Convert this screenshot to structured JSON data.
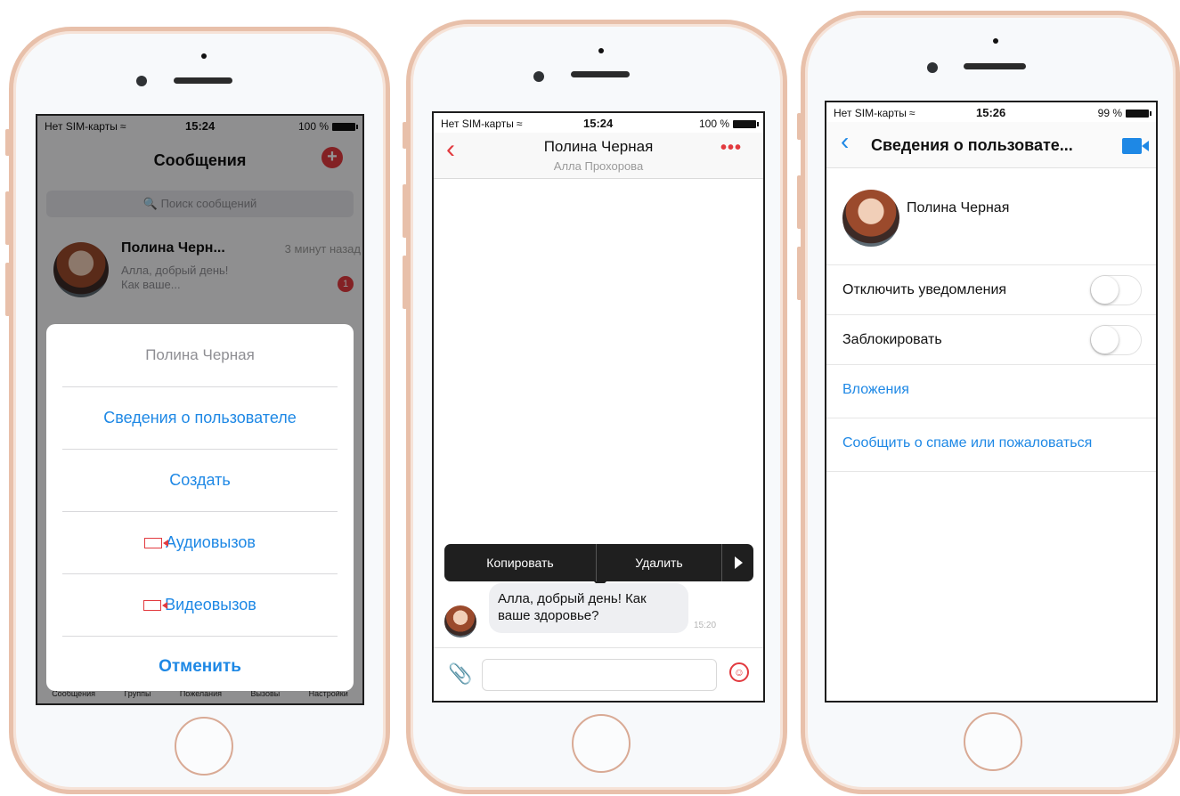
{
  "colors": {
    "accent_red": "#e23a3f",
    "link_blue": "#1e88e5",
    "frame": "#e8c0aa"
  },
  "status_left": {
    "carrier": "Нет SIM-карты",
    "time": "15:24",
    "battery": "100 %"
  },
  "status_mid": {
    "carrier": "Нет SIM-карты",
    "time": "15:24",
    "battery": "100 %"
  },
  "status_right": {
    "carrier": "Нет SIM-карты",
    "time": "15:26",
    "battery": "99 %"
  },
  "messages_screen": {
    "title": "Сообщения",
    "compose_icon": "+",
    "search_placeholder": "Поиск сообщений",
    "conversation": {
      "name": "Полина Черн...",
      "time_ago": "3 минут назад",
      "preview": "Алла, добрый день! Как ваше...",
      "unread": "1"
    },
    "tabs": [
      "Сообщения",
      "Группы",
      "Пожелания",
      "Вызовы",
      "Настройки"
    ],
    "action_sheet": {
      "title": "Полина Черная",
      "items": [
        "Сведения о пользователе",
        "Создать",
        "Аудиовызов",
        "Видеовызов"
      ],
      "cancel": "Отменить"
    }
  },
  "chat_screen": {
    "contact_name": "Полина Черная",
    "subtitle": "Алла Прохорова",
    "more_icon": "•••",
    "context_menu": {
      "copy": "Копировать",
      "delete": "Удалить"
    },
    "message": {
      "text": "Алла, добрый день! Как ваше здоровье?",
      "time": "15:20"
    }
  },
  "profile_screen": {
    "title": "Сведения о пользовате...",
    "name": "Полина Черная",
    "mute_label": "Отключить уведомления",
    "block_label": "Заблокировать",
    "attachments": "Вложения",
    "report": "Сообщить о спаме или пожаловаться"
  }
}
